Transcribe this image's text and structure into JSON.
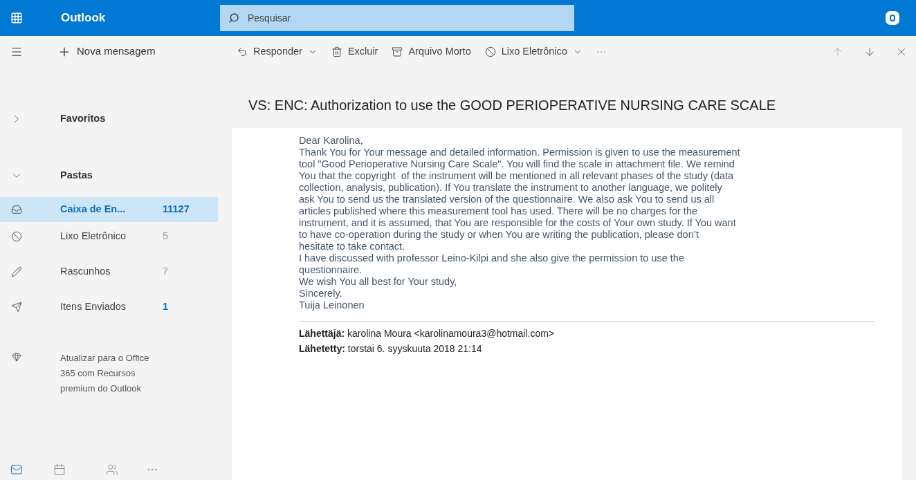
{
  "app": {
    "name": "Outlook",
    "search_placeholder": "Pesquisar"
  },
  "toolbar": {
    "new_message": "Nova mensagem",
    "actions": [
      {
        "kind": "reply",
        "label": "Responder"
      },
      {
        "kind": "delete",
        "label": "Excluir"
      },
      {
        "kind": "archive",
        "label": "Arquivo Morto"
      },
      {
        "kind": "junk",
        "label": "Lixo Eletrônico"
      },
      {
        "kind": "more",
        "label": "···"
      }
    ]
  },
  "sidebar": {
    "sections": [
      {
        "label": "Favoritos",
        "expanded": false
      },
      {
        "label": "Pastas",
        "expanded": true
      }
    ],
    "folders": [
      {
        "kind": "inbox",
        "label": "Caixa de En...",
        "count": "11127",
        "selected": true,
        "unread": true
      },
      {
        "kind": "junk",
        "label": "Lixo Eletrônico",
        "count": "5",
        "selected": false,
        "unread": false
      },
      {
        "kind": "drafts",
        "label": "Rascunhos",
        "count": "7",
        "selected": false,
        "unread": false
      },
      {
        "kind": "sent",
        "label": "Itens Enviados",
        "count": "1",
        "selected": false,
        "unread": true
      }
    ],
    "upgrade": "Atualizar para o Office 365 com Recursos premium do Outlook"
  },
  "message": {
    "subject": "VS: ENC: Authorization to use the GOOD PERIOPERATIVE NURSING CARE SCALE",
    "body_lines": [
      "Dear Karolina,",
      "Thank You for Your message and detailed information. Permission is given to use the measurement",
      "tool \"Good Perioperative Nursing Care Scale\". You will find the scale in attachment file. We remind",
      "You that the copyright  of the instrument will be mentioned in all relevant phases of the study (data",
      "collection, analysis, publication). If You translate the instrument to another language, we politely",
      "ask You to send us the translated version of the questionnaire. We also ask You to send us all",
      "articles published where this measurement tool has used. There will be no charges for the",
      "instrument, and it is assumed, that You are responsible for the costs of Your own study. If You want",
      "to have co-operation during the study or when You are writing the publication, please don’t",
      "hesitate to take contact.",
      "I have discussed with professor Leino-Kilpi and she also give the permission to use the",
      "questionnaire.",
      "We wish You all best for Your study,",
      "Sincerely,",
      "Tuija Leinonen"
    ],
    "headers": [
      "**Lähettäjä:** karolina Moura <karolinamoura3@hotmail.com>",
      "**Lähetetty:** torstai 6. syyskuuta 2018 21:14"
    ]
  }
}
